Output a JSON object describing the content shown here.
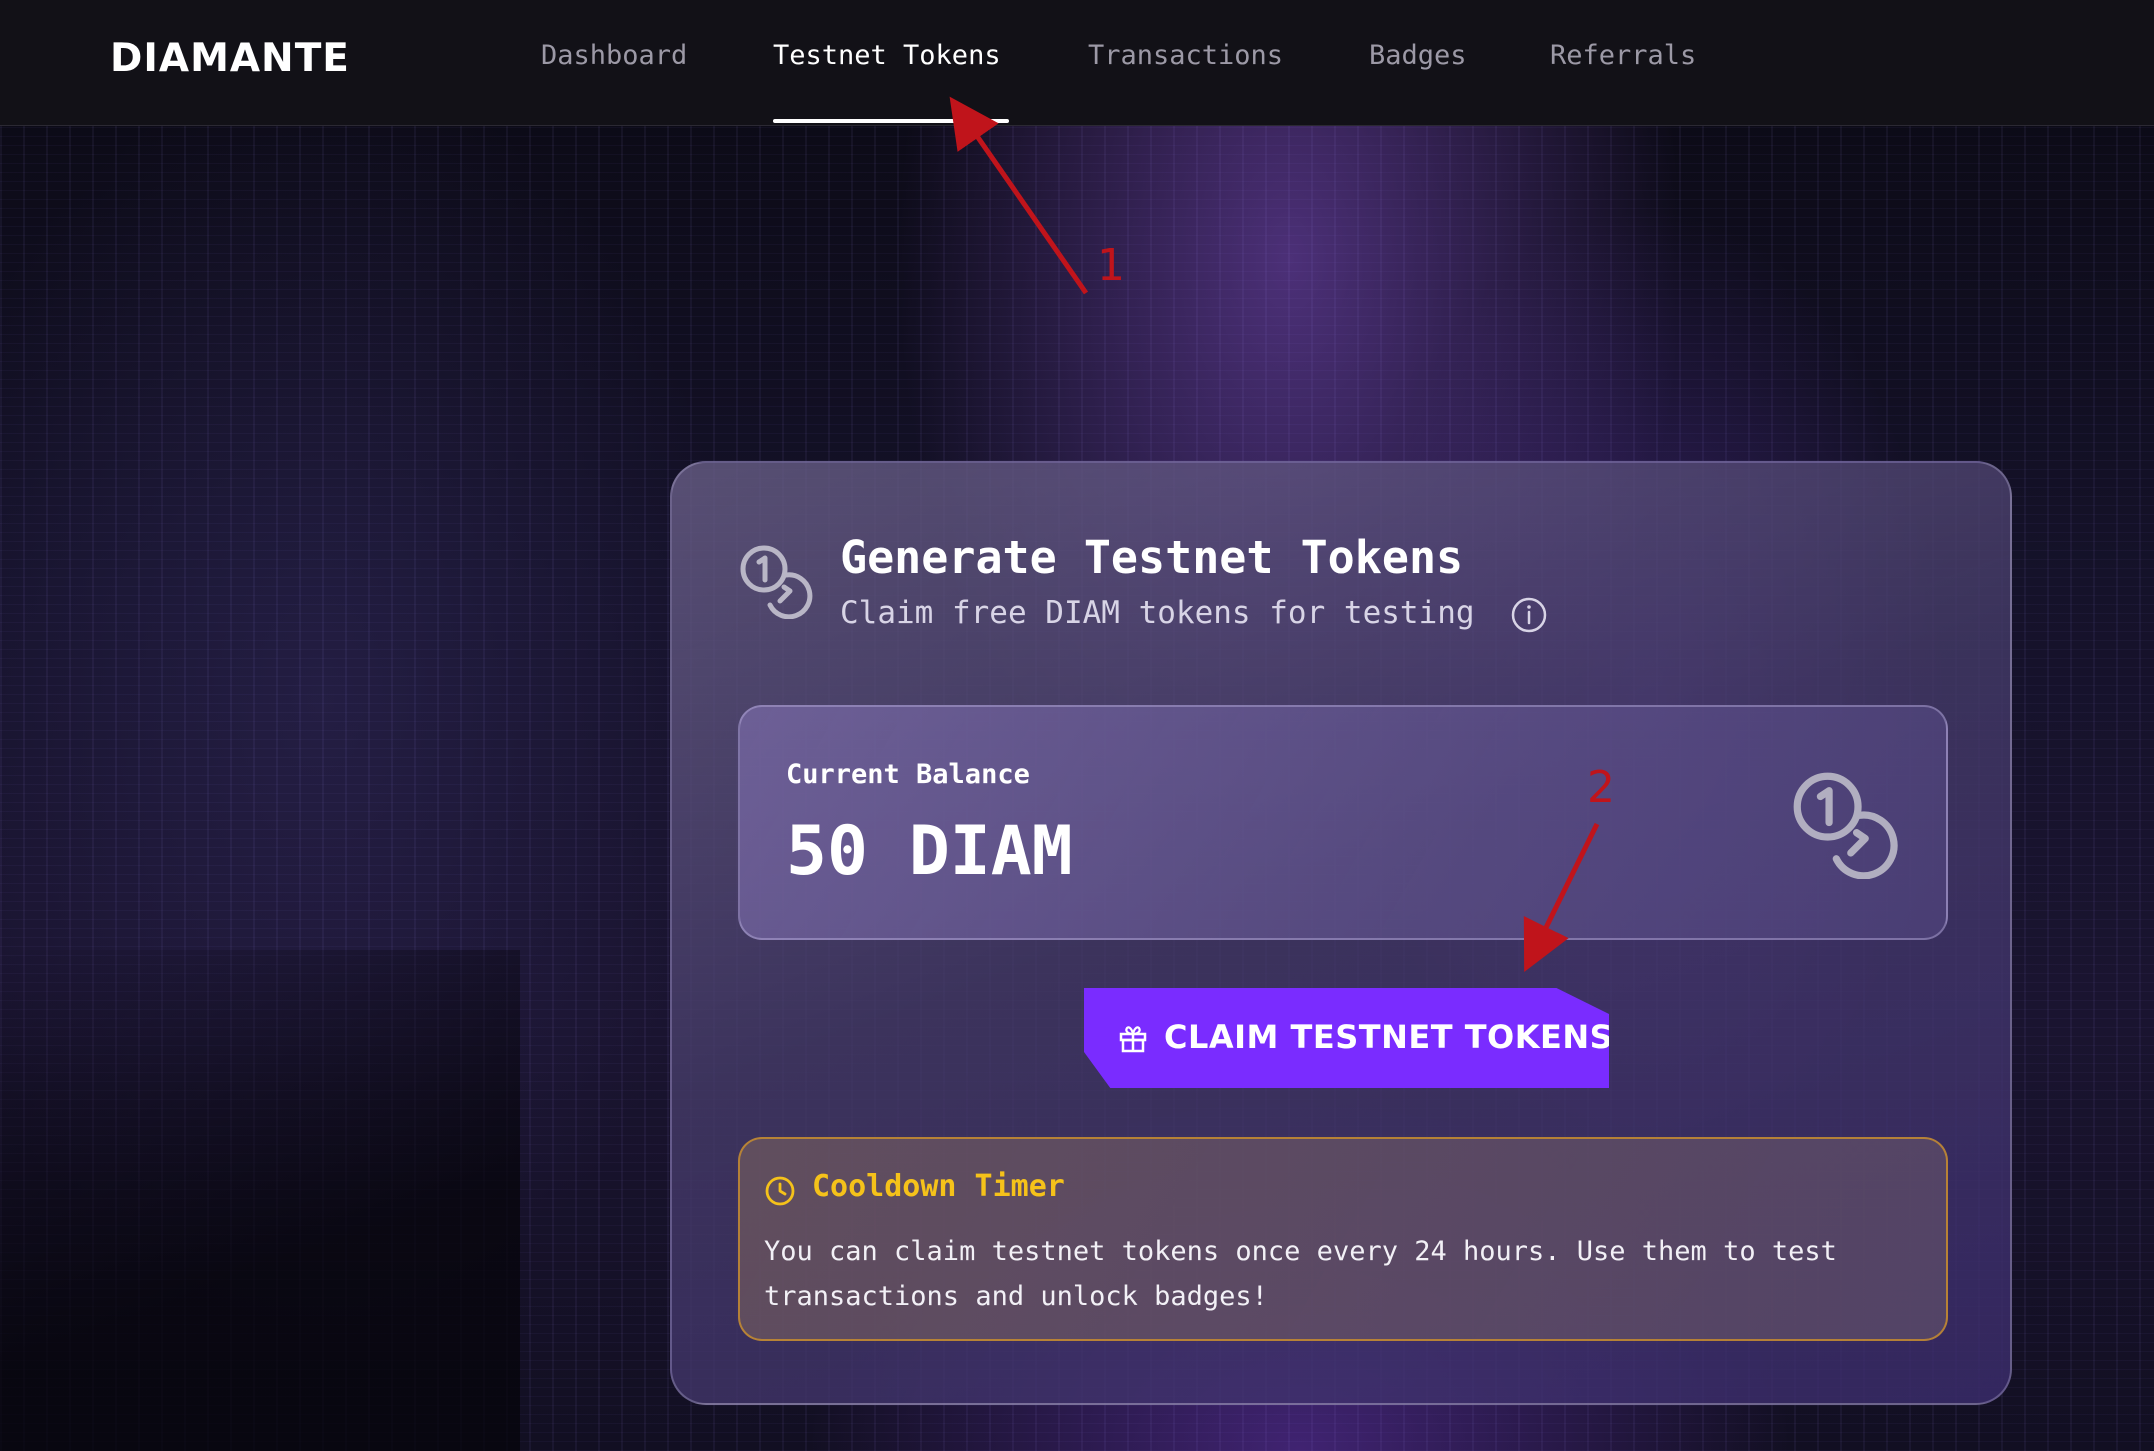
{
  "header": {
    "logo": "DIAMANTE",
    "nav": [
      {
        "label": "Dashboard",
        "active": false
      },
      {
        "label": "Testnet Tokens",
        "active": true
      },
      {
        "label": "Transactions",
        "active": false
      },
      {
        "label": "Badges",
        "active": false
      },
      {
        "label": "Referrals",
        "active": false
      }
    ]
  },
  "card": {
    "icon": "coins-icon",
    "title": "Generate Testnet Tokens",
    "subtitle": "Claim free DIAM tokens for testing",
    "info_icon": "info-icon",
    "balance": {
      "label": "Current Balance",
      "value": "50 DIAM",
      "icon": "coins-icon"
    },
    "claim_button": {
      "icon": "gift-icon",
      "label": "CLAIM TESTNET TOKENS"
    },
    "cooldown": {
      "icon": "clock-icon",
      "title": "Cooldown Timer",
      "text": "You can claim testnet tokens once every 24 hours. Use them to test transactions and unlock badges!"
    }
  },
  "annotations": [
    {
      "number": "1"
    },
    {
      "number": "2"
    }
  ],
  "colors": {
    "accent": "#7a2cff",
    "warning": "#f5c21a",
    "annotation": "#c0141b",
    "header_bg": "#121117"
  }
}
